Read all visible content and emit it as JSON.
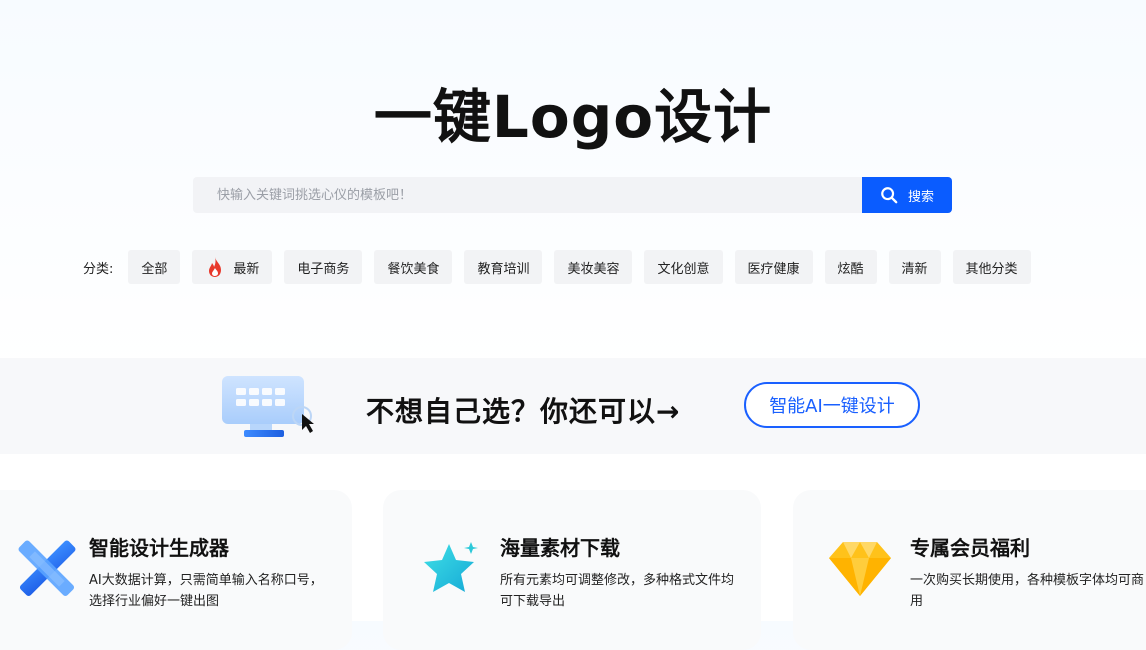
{
  "hero": {
    "title": "一键Logo设计"
  },
  "search": {
    "placeholder": "快输入关键词挑选心仪的模板吧！",
    "button_label": "搜索"
  },
  "categories": {
    "label": "分类:",
    "items": [
      "全部",
      "最新",
      "电子商务",
      "餐饮美食",
      "教育培训",
      "美妆美容",
      "文化创意",
      "医疗健康",
      "炫酷",
      "清新",
      "其他分类"
    ]
  },
  "promo": {
    "text": "不想自己选？你还可以→",
    "button_label": "智能AI一键设计"
  },
  "features": [
    {
      "title": "智能设计生成器",
      "desc": "AI大数据计算，只需简单输入名称口号，选择行业偏好一键出图"
    },
    {
      "title": "海量素材下载",
      "desc": "所有元素均可调整修改，多种格式文件均可下载导出"
    },
    {
      "title": "专属会员福利",
      "desc": "一次购买长期使用，各种模板字体均可商用"
    }
  ],
  "colors": {
    "accent": "#0a5cff",
    "hot": "#e8392c"
  }
}
